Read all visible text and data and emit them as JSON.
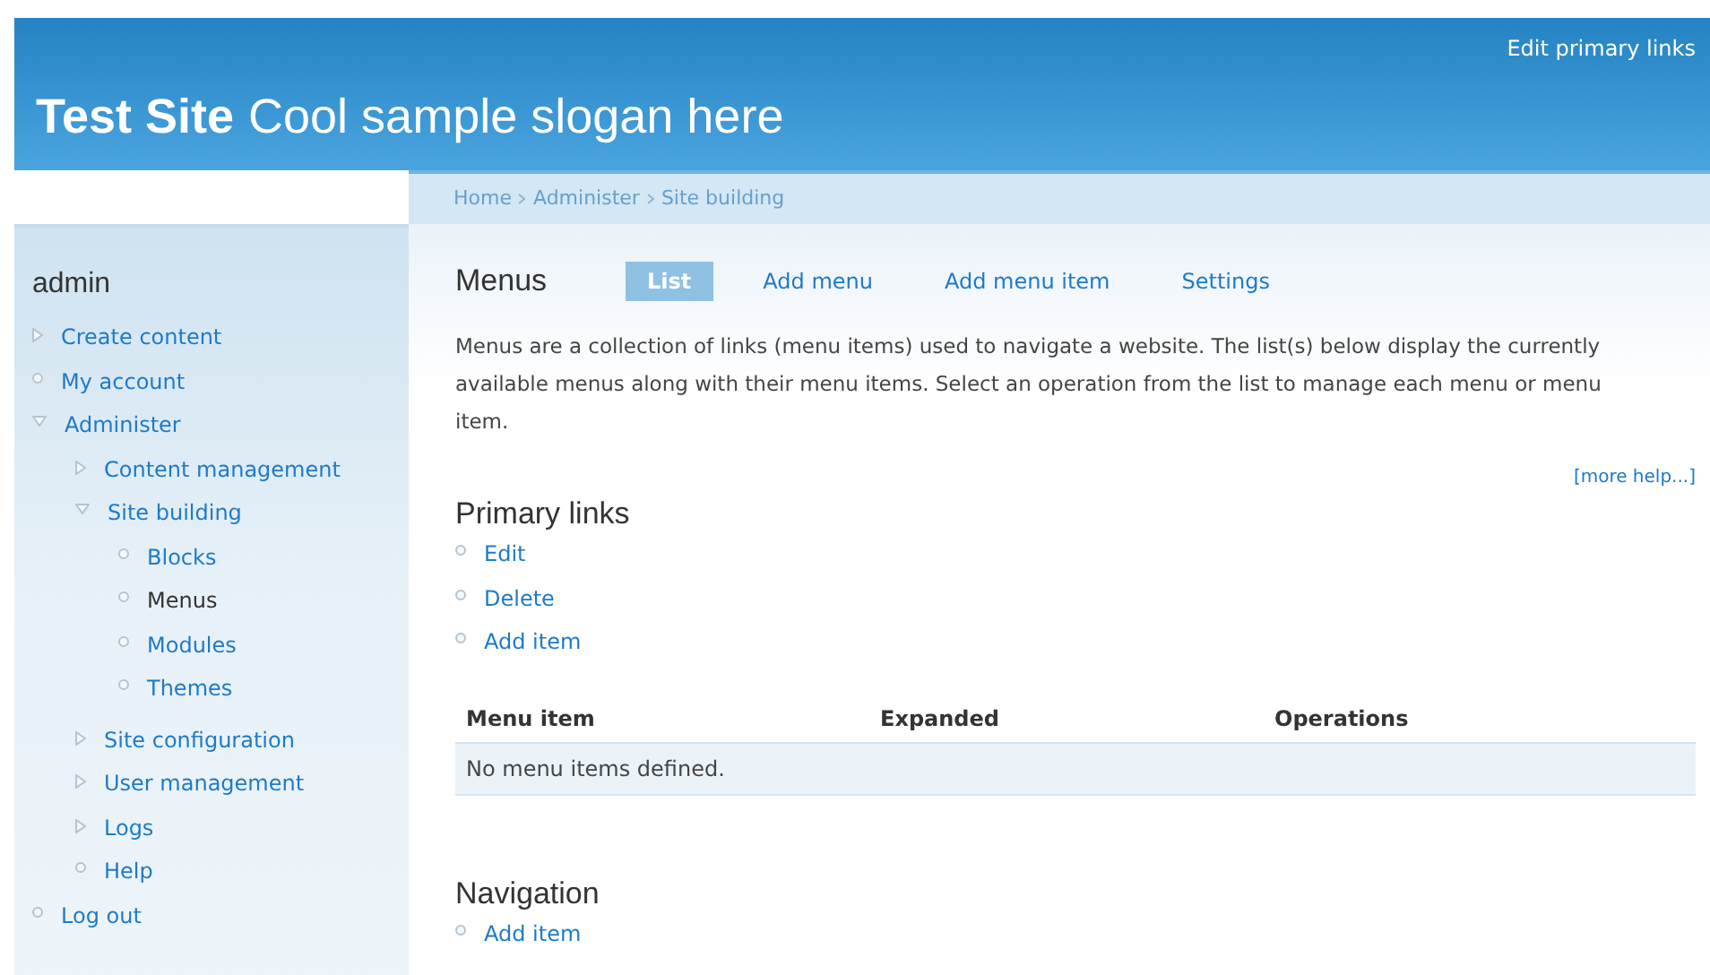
{
  "header": {
    "site_name": "Test Site",
    "slogan": "Cool sample slogan here",
    "primary_links": [
      "Edit primary links"
    ]
  },
  "breadcrumb": [
    "Home",
    "Administer",
    "Site building"
  ],
  "sidebar": {
    "title": "admin",
    "items": [
      {
        "label": "Create content",
        "kind": "collapsed",
        "selected": false
      },
      {
        "label": "My account",
        "kind": "leaf",
        "selected": false
      },
      {
        "label": "Administer",
        "kind": "expanded",
        "selected": false,
        "children": [
          {
            "label": "Content management",
            "kind": "collapsed",
            "selected": false
          },
          {
            "label": "Site building",
            "kind": "expanded",
            "selected": false,
            "children": [
              {
                "label": "Blocks",
                "kind": "leaf",
                "selected": false
              },
              {
                "label": "Menus",
                "kind": "leaf",
                "selected": true
              },
              {
                "label": "Modules",
                "kind": "leaf",
                "selected": false
              },
              {
                "label": "Themes",
                "kind": "leaf",
                "selected": false
              }
            ]
          },
          {
            "label": "Site configuration",
            "kind": "collapsed",
            "selected": false
          },
          {
            "label": "User management",
            "kind": "collapsed",
            "selected": false
          },
          {
            "label": "Logs",
            "kind": "collapsed",
            "selected": false
          },
          {
            "label": "Help",
            "kind": "leaf",
            "selected": false
          }
        ]
      },
      {
        "label": "Log out",
        "kind": "leaf",
        "selected": false
      }
    ]
  },
  "page": {
    "title": "Menus",
    "tabs": [
      {
        "label": "List",
        "selected": true
      },
      {
        "label": "Add menu",
        "selected": false
      },
      {
        "label": "Add menu item",
        "selected": false
      },
      {
        "label": "Settings",
        "selected": false
      }
    ],
    "description": "Menus are a collection of links (menu items) used to navigate a website. The list(s) below display the currently available menus along with their menu items. Select an operation from the list to manage each menu or menu item.",
    "more_help": "[more help...]",
    "menus": [
      {
        "title": "Primary links",
        "links": [
          "Edit",
          "Delete",
          "Add item"
        ],
        "table": {
          "columns": [
            "Menu item",
            "Expanded",
            "Operations"
          ],
          "empty_message": "No menu items defined."
        }
      },
      {
        "title": "Navigation",
        "links": [
          "Add item"
        ]
      }
    ]
  }
}
